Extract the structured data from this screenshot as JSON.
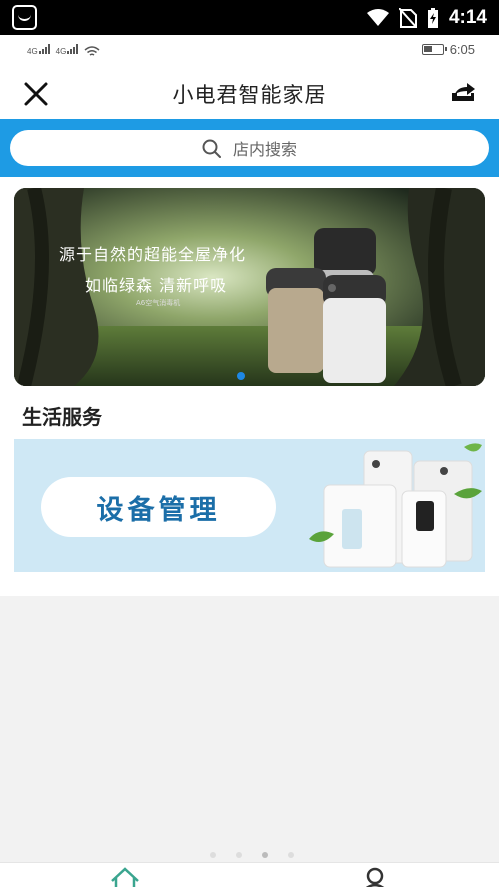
{
  "system_status": {
    "time": "4:14"
  },
  "inner_status": {
    "network_1": "4G",
    "network_2": "4G",
    "time": "6:05"
  },
  "header": {
    "title": "小电君智能家居"
  },
  "search": {
    "placeholder": "店内搜索"
  },
  "banner": {
    "headline_1": "源于自然的超能全屋净化",
    "headline_2": "如临绿森 清新呼吸",
    "product_caption": "A6空气消毒机"
  },
  "section": {
    "title": "生活服务"
  },
  "device_card": {
    "label": "设备管理"
  },
  "colors": {
    "accent": "#1e9be4",
    "nav_active": "#3aa58f"
  },
  "icons": [
    "close-icon",
    "share-icon",
    "search-icon",
    "home-icon",
    "user-icon"
  ]
}
